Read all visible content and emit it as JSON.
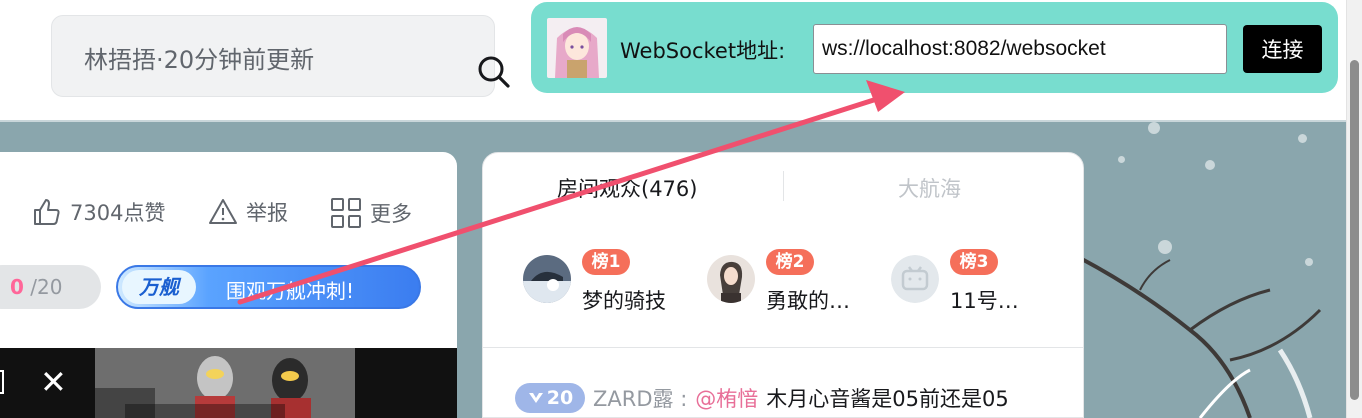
{
  "search": {
    "placeholder": "林捂捂·20分钟前更新"
  },
  "websocket": {
    "label": "WebSocket地址:",
    "value": "ws://localhost:8082/websocket",
    "connect_label": "连接"
  },
  "video": {
    "actions": [
      {
        "icon": "thumbs-up-icon",
        "label": "7304点赞"
      },
      {
        "icon": "warning-icon",
        "label": "举报"
      },
      {
        "icon": "grid-more-icon",
        "label": "更多"
      }
    ],
    "counter": {
      "current": "0",
      "total": "/20"
    },
    "promo": {
      "badge": "万舰",
      "text": "围观万舰冲刺!"
    }
  },
  "audience": {
    "tabs": [
      "房间观众(476)",
      "大航海"
    ],
    "ranks": [
      {
        "badge": "榜1",
        "name": "梦的骑技"
      },
      {
        "badge": "榜2",
        "name": "勇敢的…"
      },
      {
        "badge": "榜3",
        "name": "11号…"
      }
    ],
    "message": {
      "medal_level": "20",
      "user": "ZARD露 :",
      "at": "@栯愔",
      "text": "木月心音酱是05前还是05"
    }
  },
  "colors": {
    "ws_panel": "#78ddcf",
    "rank_badge": "#f56f5a",
    "arrow": "#f0506e",
    "highlight": "#ff6699"
  }
}
